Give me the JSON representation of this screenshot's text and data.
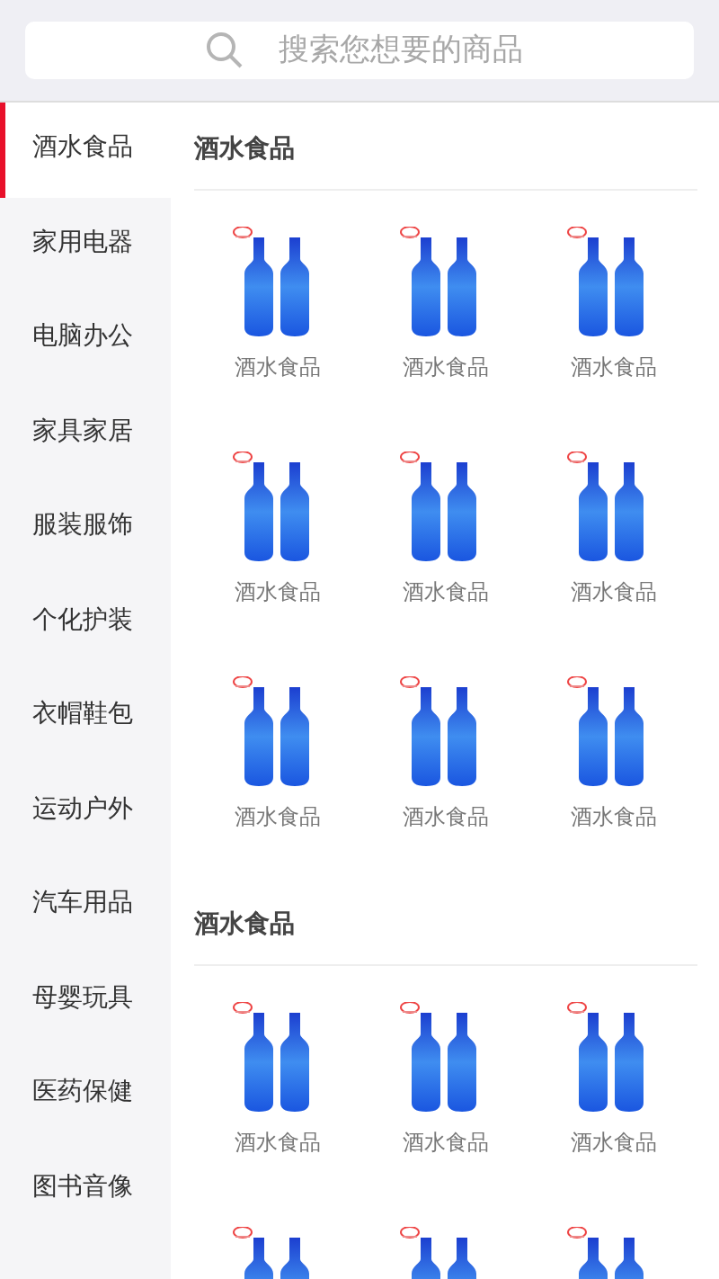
{
  "search": {
    "placeholder": "搜索您想要的商品"
  },
  "sidebar": {
    "items": [
      {
        "label": "酒水食品",
        "selected": true
      },
      {
        "label": "家用电器",
        "selected": false
      },
      {
        "label": "电脑办公",
        "selected": false
      },
      {
        "label": "家具家居",
        "selected": false
      },
      {
        "label": "服装服饰",
        "selected": false
      },
      {
        "label": "个化护装",
        "selected": false
      },
      {
        "label": "衣帽鞋包",
        "selected": false
      },
      {
        "label": "运动户外",
        "selected": false
      },
      {
        "label": "汽车用品",
        "selected": false
      },
      {
        "label": "母婴玩具",
        "selected": false
      },
      {
        "label": "医药保健",
        "selected": false
      },
      {
        "label": "图书音像",
        "selected": false
      }
    ]
  },
  "sections": [
    {
      "title": "酒水食品",
      "items": [
        {
          "kind": "product",
          "name": "酒水食品"
        },
        {
          "kind": "product",
          "name": "酒水食品"
        },
        {
          "kind": "product",
          "name": "酒水食品"
        },
        {
          "kind": "product",
          "name": "酒水食品"
        },
        {
          "kind": "product",
          "name": "酒水食品"
        },
        {
          "kind": "product",
          "name": "酒水食品"
        },
        {
          "kind": "product",
          "name": "酒水食品"
        },
        {
          "kind": "product",
          "name": "酒水食品"
        },
        {
          "kind": "product",
          "name": "酒水食品"
        }
      ]
    },
    {
      "title": "酒水食品",
      "items": [
        {
          "kind": "product",
          "name": "酒水食品"
        },
        {
          "kind": "product",
          "name": "酒水食品"
        },
        {
          "kind": "product",
          "name": "酒水食品"
        },
        {
          "kind": "image_only"
        },
        {
          "kind": "image_only"
        },
        {
          "kind": "image_only"
        }
      ]
    }
  ]
}
